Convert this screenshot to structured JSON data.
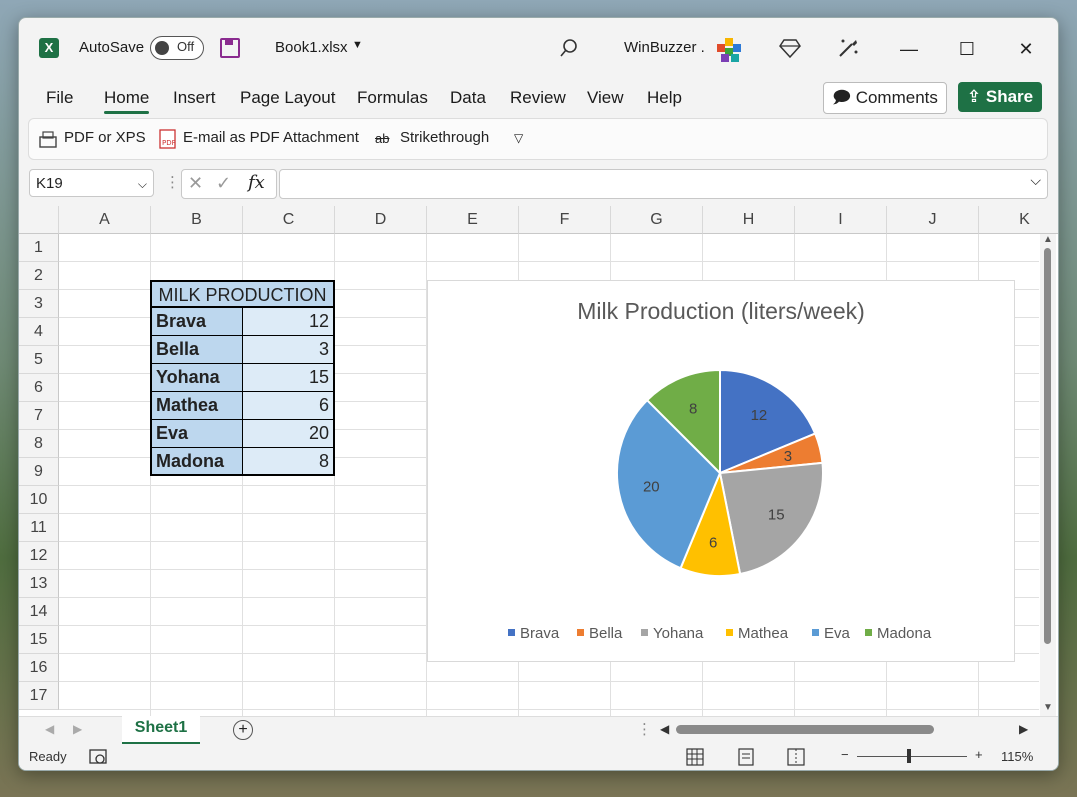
{
  "title_bar": {
    "autosave_label": "AutoSave",
    "autosave_state": "Off",
    "file_name": "Book1.xlsx",
    "user_name": "WinBuzzer ."
  },
  "menu": {
    "items": [
      "File",
      "Home",
      "Insert",
      "Page Layout",
      "Formulas",
      "Data",
      "Review",
      "View",
      "Help"
    ],
    "active": "Home",
    "comments_label": "Comments",
    "share_label": "Share"
  },
  "quick_access": {
    "pdf_xps": "PDF or XPS",
    "email_pdf": "E-mail as PDF Attachment",
    "strikethrough": "Strikethrough"
  },
  "formula_bar": {
    "name_box": "K19",
    "fx": "fx",
    "value": ""
  },
  "columns": [
    "A",
    "B",
    "C",
    "D",
    "E",
    "F",
    "G",
    "H",
    "I",
    "J",
    "K"
  ],
  "rows": [
    "1",
    "2",
    "3",
    "4",
    "5",
    "6",
    "7",
    "8",
    "9",
    "10",
    "11",
    "12",
    "13",
    "14",
    "15",
    "16",
    "17"
  ],
  "table": {
    "header": "MILK PRODUCTION",
    "rows": [
      {
        "name": "Brava",
        "value": "12"
      },
      {
        "name": "Bella",
        "value": "3"
      },
      {
        "name": "Yohana",
        "value": "15"
      },
      {
        "name": "Mathea",
        "value": "6"
      },
      {
        "name": "Eva",
        "value": "20"
      },
      {
        "name": "Madona",
        "value": "8"
      }
    ]
  },
  "chart_data": {
    "type": "pie",
    "title": "Milk Production (liters/week)",
    "categories": [
      "Brava",
      "Bella",
      "Yohana",
      "Mathea",
      "Eva",
      "Madona"
    ],
    "values": [
      12,
      3,
      15,
      6,
      20,
      8
    ],
    "colors": [
      "#4472c4",
      "#ed7d31",
      "#a5a5a5",
      "#ffc000",
      "#5b9bd5",
      "#70ad47"
    ],
    "data_labels": true,
    "legend_position": "bottom"
  },
  "sheet_tabs": {
    "active": "Sheet1"
  },
  "status_bar": {
    "state": "Ready",
    "zoom": "115%"
  },
  "colors": {
    "excel_green": "#1e7145",
    "table_header_fill": "#bdd7ee",
    "table_name_fill": "#bdd7ee",
    "table_value_fill": "#ddebf7"
  }
}
